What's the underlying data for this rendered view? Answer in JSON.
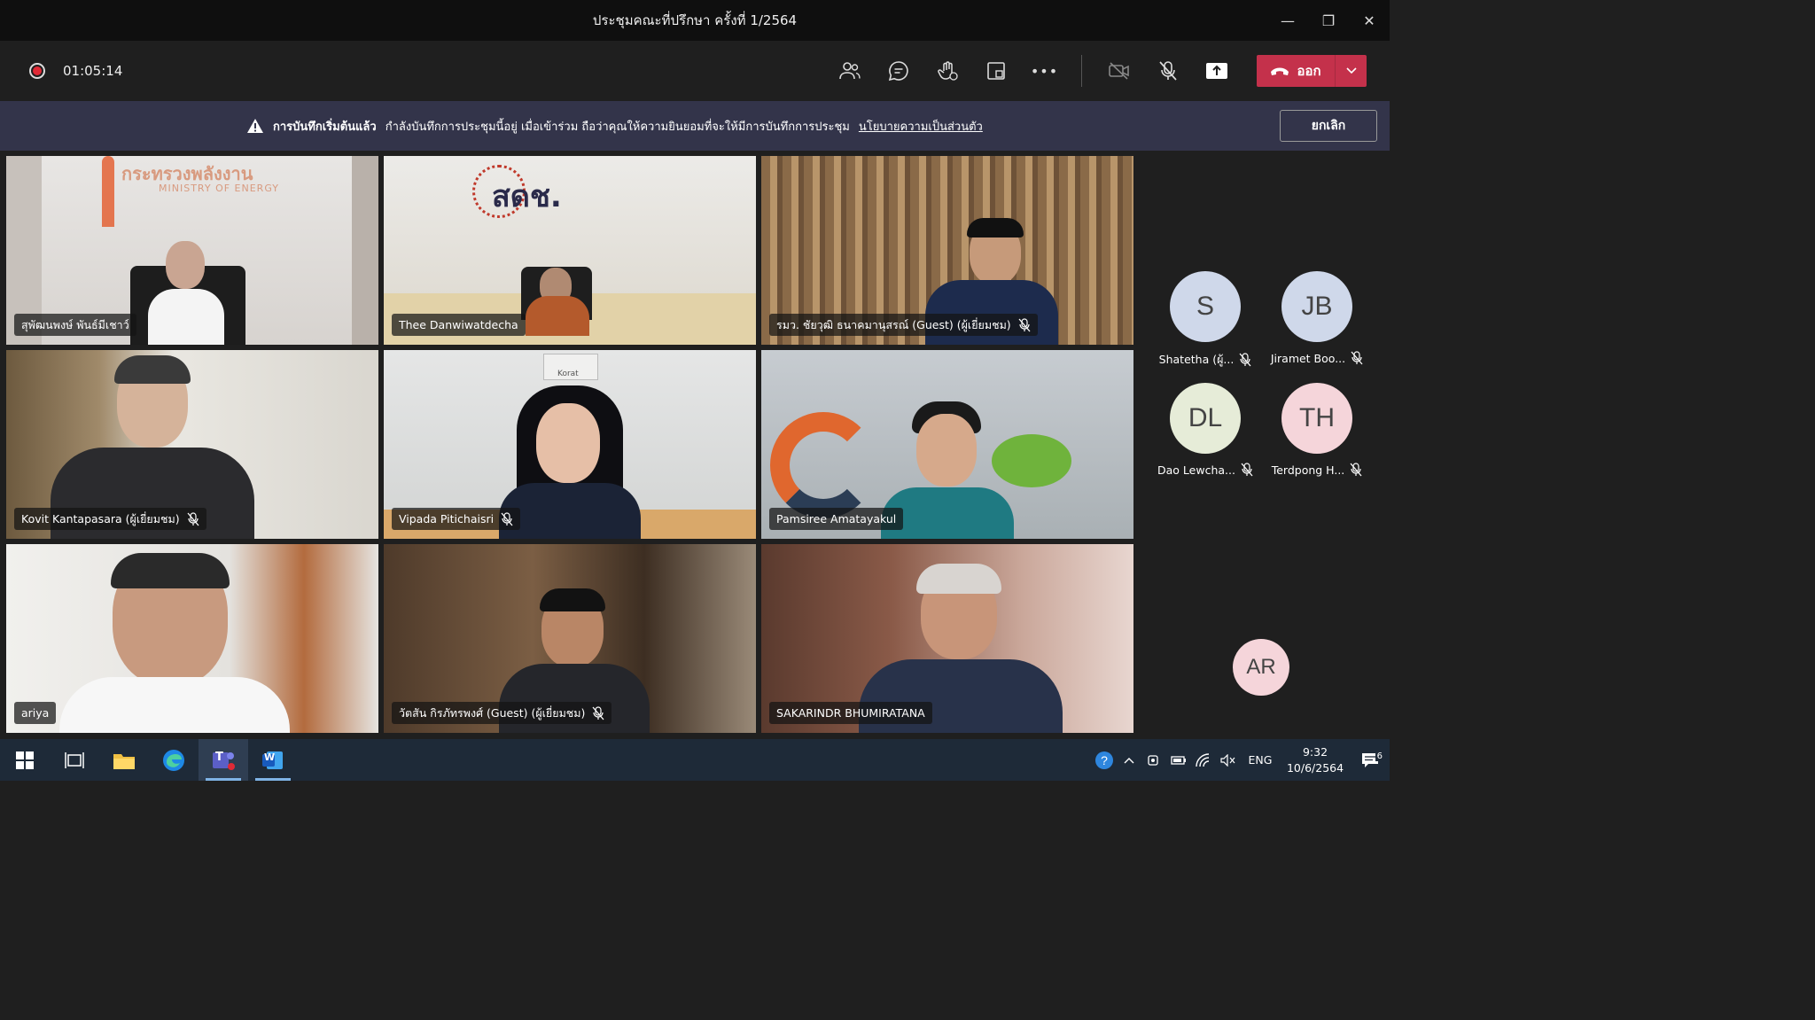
{
  "window": {
    "title": "ประชุมคณะที่ปรึกษา ครั้งที่ 1/2564",
    "minimize_glyph": "—",
    "maximize_glyph": "❐",
    "close_glyph": "✕"
  },
  "callbar": {
    "elapsed": "01:05:14",
    "leave_label": "ออก",
    "tools": [
      "people-icon",
      "chat-icon",
      "reactions-icon",
      "rooms-icon",
      "more-icon"
    ],
    "more_glyph": "•••"
  },
  "banner": {
    "title": "การบันทึกเริ่มต้นแล้ว",
    "message": "กำลังบันทึกการประชุมนี้อยู่ เมื่อเข้าร่วม ถือว่าคุณให้ความยินยอมที่จะให้มีการบันทึกการประชุม",
    "link": "นโยบายความเป็นส่วนตัว",
    "cancel_label": "ยกเลิก"
  },
  "tiles": [
    {
      "name": "สุพัฒนพงษ์ พันธ์มีเชาว์",
      "muted": false,
      "sign_text": "กระทรวงพลังงาน",
      "sign_sub": "MINISTRY OF ENERGY"
    },
    {
      "name": "Thee Danwiwatdecha",
      "muted": false,
      "sign_text": "สดช."
    },
    {
      "name": "รมว. ชัยวุฒิ ธนาคมานุสรณ์ (Guest) (ผู้เยี่ยมชม)",
      "muted": true
    },
    {
      "name": "Kovit Kantapasara (ผู้เยี่ยมชม)",
      "muted": true
    },
    {
      "name": "Vipada Pitichaisri",
      "muted": true,
      "sign_text": "Korat"
    },
    {
      "name": "Pamsiree Amatayakul",
      "muted": false
    },
    {
      "name": "ariya",
      "muted": false
    },
    {
      "name": "วัตสัน กิรภัทรพงศ์ (Guest) (ผู้เยี่ยมชม)",
      "muted": true
    },
    {
      "name": "SAKARINDR BHUMIRATANA",
      "muted": false
    }
  ],
  "avatars": [
    {
      "initials": "S",
      "label": "Shatetha (ผู้...",
      "muted": true,
      "color": "#cfd8ea"
    },
    {
      "initials": "JB",
      "label": "Jiramet Boo...",
      "muted": true,
      "color": "#cfd8ea"
    },
    {
      "initials": "DL",
      "label": "Dao Lewcha...",
      "muted": true,
      "color": "#e6ecd8"
    },
    {
      "initials": "TH",
      "label": "Terdpong H...",
      "muted": true,
      "color": "#f5d5da"
    },
    {
      "initials": "AR",
      "label": "",
      "muted": false,
      "color": "#f5d5da"
    }
  ],
  "taskbar": {
    "apps": [
      "windows-start-icon",
      "task-view-icon",
      "file-explorer-icon",
      "edge-icon",
      "teams-icon",
      "word-icon"
    ],
    "language": "ENG",
    "time": "9:32",
    "date": "10/6/2564",
    "notification_count": "6",
    "teams_letter": "T",
    "word_letter": "W"
  },
  "colors": {
    "leave": "#c4314b",
    "banner": "#33344a",
    "record": "#e02a36"
  }
}
